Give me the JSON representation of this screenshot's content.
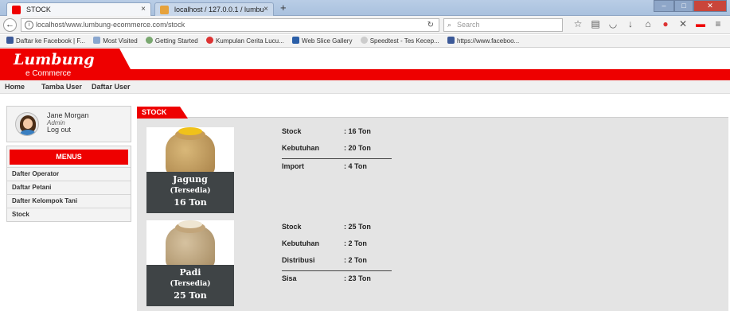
{
  "browser": {
    "tabs": [
      {
        "title": "STOCK",
        "active": true
      },
      {
        "title": "localhost / 127.0.0.1 / lumbu",
        "active": false
      }
    ],
    "new_tab": "+",
    "url": "localhost/www.lumbung-ecommerce.com/stock",
    "search_placeholder": "Search",
    "bookmarks": [
      "Daftar ke Facebook | F...",
      "Most Visited",
      "Getting Started",
      "Kumpulan Cerita Lucu...",
      "Web Slice Gallery",
      "Speedtest - Tes Kecep...",
      "https://www.faceboo..."
    ]
  },
  "site": {
    "logo": "Lumbung",
    "logo_sub": "e Commerce",
    "nav": [
      "Home",
      "Tamba User",
      "Daftar User"
    ]
  },
  "profile": {
    "name": "Jane Morgan",
    "role": "Admin",
    "logout": "Log out"
  },
  "sidebar": {
    "title": "MENUS",
    "items": [
      "Dafter Operator",
      "Daftar Petani",
      "Dafter Kelompok Tani",
      "Stock"
    ]
  },
  "content": {
    "section_tab": "STOCK",
    "products": [
      {
        "name": "Jagung",
        "status": "(Tersedia)",
        "quantity": "16 Ton",
        "rows": [
          {
            "label": "Stock",
            "value": ": 16 Ton"
          },
          {
            "label": "Kebutuhan",
            "value": ": 20 Ton"
          },
          {
            "label": "Import",
            "value": ": 4 Ton"
          }
        ]
      },
      {
        "name": "Padi",
        "status": "(Tersedia)",
        "quantity": "25 Ton",
        "rows": [
          {
            "label": "Stock",
            "value": ": 25 Ton"
          },
          {
            "label": "Kebutuhan",
            "value": ": 2 Ton"
          },
          {
            "label": "Distribusi",
            "value": ": 2 Ton"
          },
          {
            "label": "Sisa",
            "value": ": 23 Ton"
          }
        ]
      }
    ]
  },
  "colors": {
    "brand_red": "#ee0000",
    "caption_bg": "#3f4446"
  }
}
